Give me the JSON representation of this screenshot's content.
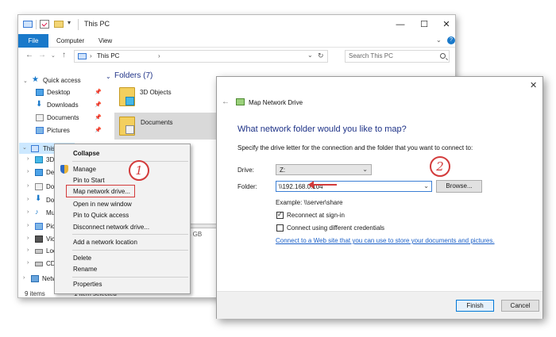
{
  "explorer": {
    "title": "This PC",
    "ribbon": {
      "file": "File",
      "computer": "Computer",
      "view": "View"
    },
    "address": {
      "location": "This PC"
    },
    "search": {
      "placeholder": "Search This PC"
    },
    "nav": {
      "quick_access": "Quick access",
      "pinned": [
        "Desktop",
        "Downloads",
        "Documents",
        "Pictures"
      ],
      "this_pc": "This PC",
      "children": [
        "3D",
        "De",
        "Do",
        "Do",
        "Mu",
        "Pic",
        "Vic",
        "Loc",
        "CD"
      ],
      "network": "Netw"
    },
    "content": {
      "folders_header": "Folders (7)",
      "folders": [
        "3D Objects",
        "Documents"
      ],
      "disk_info": "4 GB"
    },
    "status": {
      "count": "9 items",
      "selected": "1 item selected"
    }
  },
  "context_menu": {
    "collapse": "Collapse",
    "manage": "Manage",
    "pin_start": "Pin to Start",
    "map_drive": "Map network drive...",
    "open_new_window": "Open in new window",
    "pin_quick": "Pin to Quick access",
    "disconnect": "Disconnect network drive...",
    "add_location": "Add a network location",
    "delete": "Delete",
    "rename": "Rename",
    "properties": "Properties"
  },
  "steps": {
    "one": "1",
    "two": "2"
  },
  "dialog": {
    "title": "Map Network Drive",
    "heading": "What network folder would you like to map?",
    "instruction": "Specify the drive letter for the connection and the folder that you want to connect to:",
    "drive_label": "Drive:",
    "drive_value": "Z:",
    "folder_label": "Folder:",
    "folder_value": "\\\\192.168.0.104",
    "browse": "Browse...",
    "example": "Example: \\\\server\\share",
    "reconnect": "Reconnect at sign-in",
    "reconnect_checked": true,
    "different_creds": "Connect using different credentials",
    "different_creds_checked": false,
    "link": "Connect to a Web site that you can use to store your documents and pictures.",
    "finish": "Finish",
    "cancel": "Cancel"
  },
  "colors": {
    "accent": "#1979ca",
    "annotation": "#d33b3b",
    "heading": "#1e3287"
  }
}
